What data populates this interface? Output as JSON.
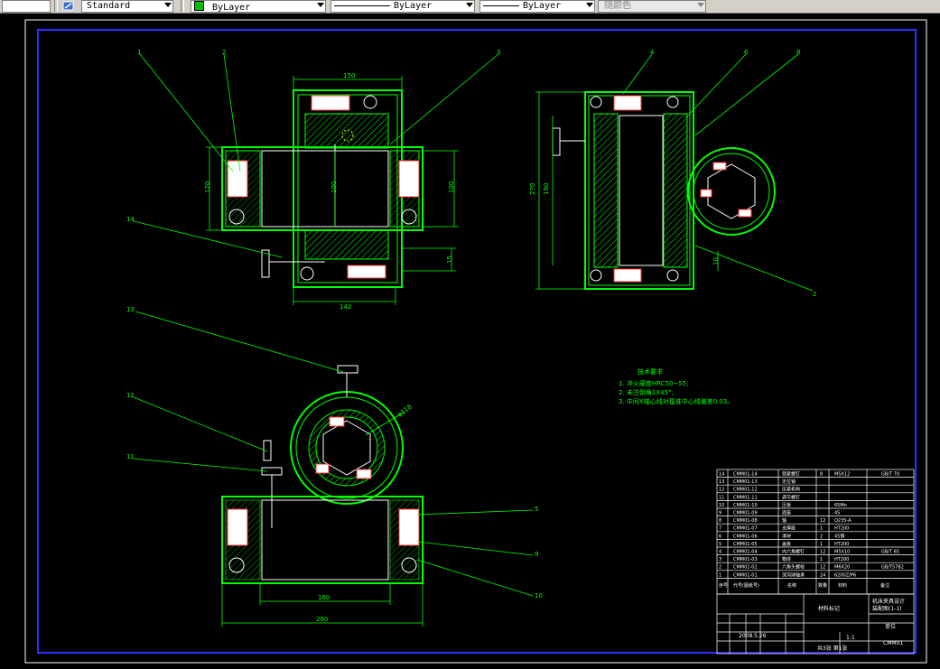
{
  "toolbar": {
    "text_style": "Standard",
    "layer_color": "ByLayer",
    "linetype": "ByLayer",
    "lineweight": "ByLayer",
    "plot_style": "随颜色"
  },
  "balloons": {
    "front": [
      "1",
      "2",
      "3",
      "14"
    ],
    "side": [
      "4",
      "6",
      "8",
      "2"
    ],
    "plan": [
      "13",
      "12",
      "11",
      "5",
      "9",
      "10"
    ]
  },
  "dims": {
    "top_width": "150",
    "bottom_width": "142",
    "left_height": "120",
    "inner_height": "100",
    "right_height": "100",
    "small_a": "15",
    "small_b": "15",
    "side_outer": "270",
    "side_inner": "190",
    "side_small": "10",
    "plan_inner_width": "160",
    "plan_outer_width": "260",
    "circle_dia": "φ118"
  },
  "tech_notes": {
    "title": "技术要求",
    "items": [
      "1. 淬火硬度HRC50~55;",
      "2. 未注倒角1X45°;",
      "3. 中间X轴心线对基准中心线偏差0.03。"
    ]
  },
  "parts": [
    {
      "no": "14",
      "code": "CMM01-14",
      "name": "锁紧螺钉",
      "qty": "8",
      "mat": "M5X12",
      "std": "GB/T 70"
    },
    {
      "no": "13",
      "code": "CMM01-13",
      "name": "定位销",
      "qty": "",
      "mat": "",
      "std": ""
    },
    {
      "no": "12",
      "code": "CMM01-12",
      "name": "压紧机构",
      "qty": "",
      "mat": "",
      "std": ""
    },
    {
      "no": "11",
      "code": "CMM01-11",
      "name": "调节螺钉",
      "qty": "",
      "mat": "",
      "std": ""
    },
    {
      "no": "10",
      "code": "CMM01-10",
      "name": "压板",
      "qty": "",
      "mat": "65Mn",
      "std": ""
    },
    {
      "no": "9",
      "code": "CMM01-09",
      "name": "底座",
      "qty": "",
      "mat": "45",
      "std": ""
    },
    {
      "no": "8",
      "code": "CMM01-08",
      "name": "轴",
      "qty": "12",
      "mat": "Q235-A",
      "std": ""
    },
    {
      "no": "7",
      "code": "CMM01-07",
      "name": "支撑座",
      "qty": "1",
      "mat": "HT200",
      "std": ""
    },
    {
      "no": "6",
      "code": "CMM01-06",
      "name": "滑块",
      "qty": "2",
      "mat": "45钢",
      "std": ""
    },
    {
      "no": "5",
      "code": "CMM01-05",
      "name": "盖板",
      "qty": "1",
      "mat": "HT200",
      "std": ""
    },
    {
      "no": "4",
      "code": "CMM01-04",
      "name": "内六角螺钉",
      "qty": "12",
      "mat": "M5X10",
      "std": "GB/T 65"
    },
    {
      "no": "3",
      "code": "CMM01-03",
      "name": "箱体",
      "qty": "1",
      "mat": "HT200",
      "std": ""
    },
    {
      "no": "2",
      "code": "CMM01-02",
      "name": "六角头螺栓",
      "qty": "12",
      "mat": "M6X20",
      "std": "GB/T5782"
    },
    {
      "no": "1",
      "code": "CMM01-01",
      "name": "深沟球轴承",
      "qty": "24",
      "mat": "6200Z/P6",
      "std": ""
    }
  ],
  "parts_header": {
    "no": "序号",
    "code": "代号(图纸号)",
    "name": "名称",
    "qty": "数量",
    "mat": "材料",
    "std": "备注"
  },
  "title_block": {
    "title": "机床夹具设计",
    "subtitle": "装配图(1-1)",
    "material": "材料标记",
    "drawing_no": "CMM01",
    "scale": "1:1",
    "sheets": "共3张 第1张",
    "unit": "单位",
    "date": "2008.5.26"
  }
}
